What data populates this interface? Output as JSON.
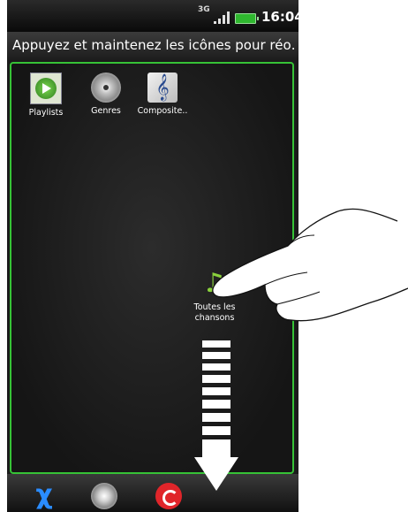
{
  "status_bar": {
    "network": "3G",
    "time": "16:04"
  },
  "title_bar": {
    "text": "Appuyez et maintenez les icônes pour réo…"
  },
  "tiles": [
    {
      "label": "Playlists",
      "icon": "playlists-icon"
    },
    {
      "label": "Genres",
      "icon": "genres-disc-icon"
    },
    {
      "label": "Composite..",
      "icon": "composers-icon"
    }
  ],
  "dragged_tile": {
    "label_line1": "Toutes les",
    "label_line2": "chansons",
    "icon": "all-songs-note-icon"
  },
  "bottom_bar": [
    {
      "icon": "artists-person-icon"
    },
    {
      "icon": "albums-disc-icon"
    },
    {
      "icon": "recently-played-icon"
    }
  ],
  "colors": {
    "accent_green": "#36c236",
    "background": "#1b1b1b"
  }
}
